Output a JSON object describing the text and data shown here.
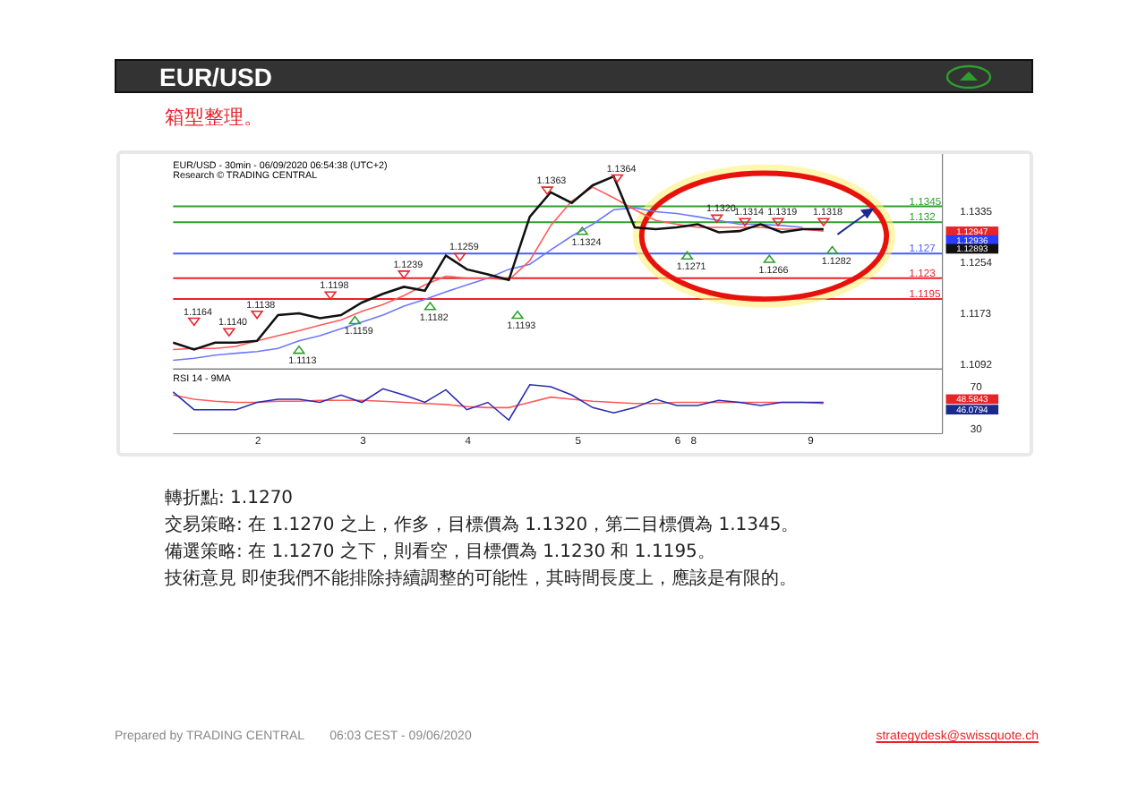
{
  "header": {
    "title": "EUR/USD"
  },
  "subtitle": "箱型整理。",
  "chart": {
    "title": "EUR/USD - 30min - 06/09/2020 06:54:38 (UTC+2)",
    "source": "Research © TRADING CENTRAL",
    "chart_data": {
      "type": "line",
      "categories": [
        null,
        null,
        null,
        null,
        null,
        null,
        null,
        null,
        null,
        null,
        null,
        null,
        null,
        null,
        null,
        null,
        null,
        null,
        null,
        null,
        null,
        null,
        null,
        null,
        null,
        null,
        null,
        null,
        null,
        null,
        null,
        null
      ],
      "ylim": [
        1.1084,
        1.1427
      ],
      "yticks": [
        {
          "value": 1.1335,
          "label": "1.1335"
        },
        {
          "value": 1.1254,
          "label": "1.1254"
        },
        {
          "value": 1.1173,
          "label": "1.1173"
        },
        {
          "value": 1.1092,
          "label": "1.1092"
        }
      ],
      "series": [
        {
          "color": "#6b78ff",
          "values": [
            1.1098,
            1.1101,
            1.1106,
            1.1109,
            1.1112,
            1.1117,
            1.1129,
            1.1137,
            1.1148,
            1.1159,
            1.117,
            1.1184,
            1.1195,
            1.1207,
            1.1218,
            1.1229,
            1.1243,
            1.1251,
            1.1274,
            1.1296,
            1.1315,
            1.1338,
            1.1341,
            1.1335,
            1.1332,
            1.1327,
            1.1321,
            1.1315,
            1.1315,
            1.1313,
            1.131,
            null
          ]
        },
        {
          "color": "#ff5a5a",
          "values": [
            1.1115,
            1.1117,
            1.1117,
            1.112,
            1.1129,
            1.1137,
            1.1145,
            1.1154,
            1.1162,
            1.1176,
            1.1187,
            1.1201,
            1.1218,
            1.1232,
            1.1229,
            1.1229,
            1.1226,
            1.1257,
            1.1313,
            1.1352,
            1.1374,
            1.1357,
            1.1338,
            1.1321,
            1.1315,
            1.131,
            1.131,
            1.131,
            1.131,
            1.1307,
            1.1307,
            1.1304
          ]
        },
        {
          "color": "#111111",
          "values": [
            1.1126,
            1.1115,
            1.1126,
            1.1126,
            1.1129,
            1.117,
            1.1173,
            1.1165,
            1.117,
            1.119,
            1.1204,
            1.1215,
            1.1209,
            1.1265,
            1.1243,
            1.1235,
            1.1226,
            1.1327,
            1.1366,
            1.1349,
            1.1377,
            1.1391,
            1.131,
            1.1307,
            1.131,
            1.1315,
            1.1302,
            1.1304,
            1.1315,
            1.1302,
            1.1307,
            1.1307
          ]
        }
      ]
    },
    "high_labels": [
      "1.1164",
      "1.1140",
      "1.1138",
      "1.1198",
      "1.1239",
      "1.1259",
      "1.1363",
      "1.1364",
      "1.1320",
      "1.1314",
      "1.1319",
      "1.1318"
    ],
    "low_labels": [
      "1.1113",
      "1.1159",
      "1.1182",
      "1.1193",
      "1.1324",
      "1.1271",
      "1.1266",
      "1.1282"
    ],
    "line_labels": [
      {
        "text": "1.1345",
        "color": "#2ca02c"
      },
      {
        "text": "1.132",
        "color": "#2ca02c"
      },
      {
        "text": "1.127",
        "color": "#4a5cff"
      },
      {
        "text": "1.123",
        "color": "#e8242b"
      },
      {
        "text": "1.1195",
        "color": "#e8242b"
      }
    ],
    "price_tags": [
      {
        "text": "1.12947",
        "color": "#e8242b"
      },
      {
        "text": "1.12936",
        "color": "#2b3cff"
      },
      {
        "text": "1.12893",
        "color": "#111111"
      }
    ],
    "rsi": {
      "label": "RSI 14 - 9MA",
      "chart_data": {
        "type": "line",
        "categories": [
          null,
          null,
          null,
          null,
          null,
          null,
          null,
          null,
          null,
          null,
          null,
          null,
          null,
          null,
          null,
          null,
          null,
          null,
          null,
          null,
          null,
          null,
          null,
          null,
          null,
          null,
          null,
          null,
          null,
          null,
          null,
          null
        ],
        "ylim": [
          25,
          87
        ],
        "yticks": [
          {
            "value": 70,
            "label": "70"
          },
          {
            "value": 30,
            "label": "30"
          }
        ],
        "series": [
          {
            "color": "#ff5a5a",
            "values": [
              62,
              58,
              56,
              55,
              55,
              56,
              56,
              57,
              57,
              57,
              56,
              55,
              54,
              53,
              51,
              50,
              50,
              55,
              60,
              58,
              56,
              55,
              54,
              54,
              55,
              55,
              55,
              55,
              55,
              55,
              55,
              54
            ]
          },
          {
            "color": "#2a2ab0",
            "values": [
              65,
              48,
              48,
              48,
              55,
              58,
              58,
              55,
              62,
              55,
              68,
              62,
              55,
              67,
              48,
              55,
              38,
              72,
              70,
              62,
              50,
              45,
              50,
              58,
              52,
              52,
              57,
              55,
              52,
              55,
              55,
              55
            ]
          }
        ]
      },
      "tags": [
        {
          "text": "48.5843",
          "color": "#e8242b"
        },
        {
          "text": "46.0794",
          "color": "#1a2a8c"
        }
      ]
    },
    "x_labels": [
      "2",
      "3",
      "4",
      "5",
      "6",
      "8",
      "9"
    ]
  },
  "analysis": [
    "轉折點: 1.1270",
    "交易策略: 在 1.1270 之上，作多，目標價為 1.1320，第二目標價為 1.1345。",
    "備選策略: 在 1.1270 之下，則看空，目標價為 1.1230 和 1.1195。",
    "技術意見 即使我們不能排除持續調整的可能性，其時間長度上，應該是有限的。"
  ],
  "footer": {
    "prepared_by": "Prepared by TRADING CENTRAL",
    "timestamp": "06:03 CEST - 09/06/2020",
    "email": "strategydesk@swissquote.ch"
  }
}
